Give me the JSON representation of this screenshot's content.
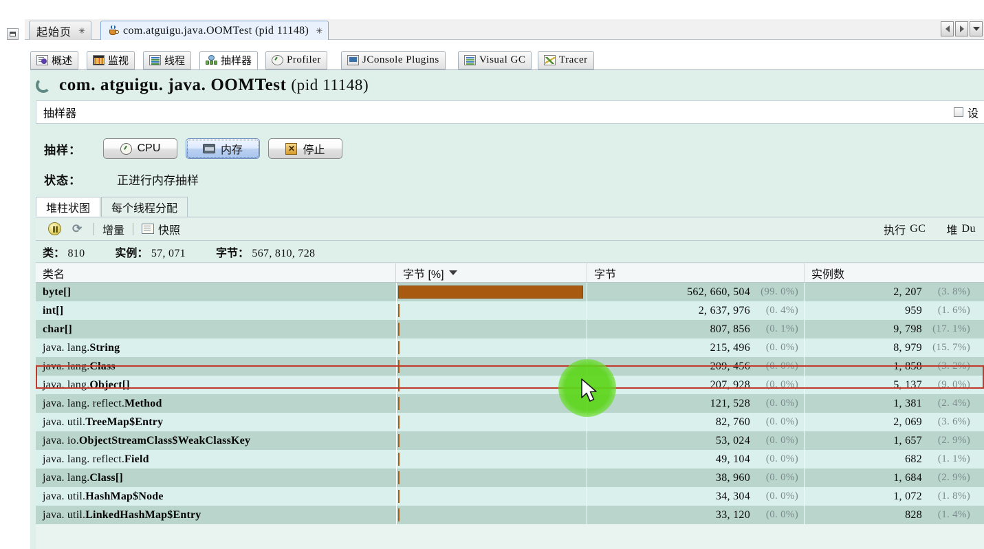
{
  "window": {
    "restore_icon": "restore-window-icon"
  },
  "document_tabs": {
    "tabs": [
      {
        "label": "起始页",
        "active": false,
        "icon": "",
        "close": "✳"
      },
      {
        "label": "com.atguigu.java.OOMTest (pid 11148)",
        "active": true,
        "icon": "java-cup-icon",
        "close": "✳"
      }
    ],
    "nav": {
      "prev": "scroll-left-icon",
      "next": "scroll-right-icon",
      "list": "tab-list-icon"
    }
  },
  "view_tabs": [
    {
      "label": "概述",
      "icon": "overview-icon",
      "active": false,
      "mono": false
    },
    {
      "label": "监视",
      "icon": "monitor-icon",
      "active": false,
      "mono": false
    },
    {
      "label": "线程",
      "icon": "threads-icon",
      "active": false,
      "mono": false
    },
    {
      "label": "抽样器",
      "icon": "sampler-icon",
      "active": true,
      "mono": false
    },
    {
      "label": "Profiler",
      "icon": "profiler-icon",
      "active": false,
      "mono": true
    },
    {
      "label": "JConsole Plugins",
      "icon": "jconsole-icon",
      "active": false,
      "mono": true
    },
    {
      "label": "Visual GC",
      "icon": "visualgc-icon",
      "active": false,
      "mono": true
    },
    {
      "label": "Tracer",
      "icon": "tracer-icon",
      "active": false,
      "mono": true
    }
  ],
  "app_header": {
    "title": "com. atguigu. java. OOMTest",
    "pid": "(pid 11148)",
    "refresh_icon": "refresh-spinner-icon"
  },
  "section": {
    "title": "抽样器",
    "settings_label": "设",
    "settings_checked": false
  },
  "sampling": {
    "label": "抽样：",
    "buttons": [
      {
        "label": "CPU",
        "icon": "clock-icon",
        "selected": false
      },
      {
        "label": "内存",
        "icon": "memory-icon",
        "selected": true
      },
      {
        "label": "停止",
        "icon": "stop-icon",
        "selected": false
      }
    ],
    "status_label": "状态：",
    "status_value": "正进行内存抽样"
  },
  "sub_tabs": [
    {
      "label": "堆柱状图",
      "active": true
    },
    {
      "label": "每个线程分配",
      "active": false
    }
  ],
  "sampler_toolbar": {
    "pause_icon": "pause-icon",
    "refresh_icon": "refresh-icon",
    "delta_label": "增量",
    "snapshot_icon": "snapshot-icon",
    "snapshot_label": "快照",
    "gc_label": "执行",
    "gc_value": "GC",
    "heap_label": "堆",
    "heap_value": "Du"
  },
  "stats": [
    {
      "label": "类：",
      "value": "810"
    },
    {
      "label": "实例：",
      "value": "57, 071"
    },
    {
      "label": "字节：",
      "value": "567, 810, 728"
    }
  ],
  "table": {
    "columns": [
      {
        "label": "类名",
        "sorted": false
      },
      {
        "label": "字节 [%]",
        "sorted": true,
        "caret": "▼"
      },
      {
        "label": "字节",
        "sorted": false
      },
      {
        "label": "实例数",
        "sorted": false
      }
    ],
    "rows": [
      {
        "pkg": "",
        "cls": "byte[]",
        "bar_pct": 99.0,
        "bytes": "562, 660, 504",
        "bytes_pct": "(99. 0%)",
        "instances": "2, 207",
        "inst_pct": "(3. 8%)",
        "selected": true
      },
      {
        "pkg": "",
        "cls": "int[]",
        "bar_pct": 0.4,
        "bytes": "2, 637, 976",
        "bytes_pct": "(0. 4%)",
        "instances": "959",
        "inst_pct": "(1. 6%)",
        "selected": false
      },
      {
        "pkg": "",
        "cls": "char[]",
        "bar_pct": 0.1,
        "bytes": "807, 856",
        "bytes_pct": "(0. 1%)",
        "instances": "9, 798",
        "inst_pct": "(17. 1%)",
        "selected": false
      },
      {
        "pkg": "java. lang.",
        "cls": "String",
        "bar_pct": 0.04,
        "bytes": "215, 496",
        "bytes_pct": "(0. 0%)",
        "instances": "8, 979",
        "inst_pct": "(15. 7%)",
        "selected": false
      },
      {
        "pkg": "java. lang.",
        "cls": "Class",
        "bar_pct": 0.04,
        "bytes": "209, 456",
        "bytes_pct": "(0. 0%)",
        "instances": "1, 858",
        "inst_pct": "(3. 2%)",
        "selected": false
      },
      {
        "pkg": "java. lang.",
        "cls": "Object[]",
        "bar_pct": 0.04,
        "bytes": "207, 928",
        "bytes_pct": "(0. 0%)",
        "instances": "5, 137",
        "inst_pct": "(9. 0%)",
        "selected": false
      },
      {
        "pkg": "java. lang. reflect.",
        "cls": "Method",
        "bar_pct": 0.02,
        "bytes": "121, 528",
        "bytes_pct": "(0. 0%)",
        "instances": "1, 381",
        "inst_pct": "(2. 4%)",
        "selected": false
      },
      {
        "pkg": "java. util.",
        "cls": "TreeMap$Entry",
        "bar_pct": 0.015,
        "bytes": "82, 760",
        "bytes_pct": "(0. 0%)",
        "instances": "2, 069",
        "inst_pct": "(3. 6%)",
        "selected": false
      },
      {
        "pkg": "java. io.",
        "cls": "ObjectStreamClass$WeakClassKey",
        "bar_pct": 0.01,
        "bytes": "53, 024",
        "bytes_pct": "(0. 0%)",
        "instances": "1, 657",
        "inst_pct": "(2. 9%)",
        "selected": false
      },
      {
        "pkg": "java. lang. reflect.",
        "cls": "Field",
        "bar_pct": 0.009,
        "bytes": "49, 104",
        "bytes_pct": "(0. 0%)",
        "instances": "682",
        "inst_pct": "(1. 1%)",
        "selected": false
      },
      {
        "pkg": "java. lang.",
        "cls": "Class[]",
        "bar_pct": 0.007,
        "bytes": "38, 960",
        "bytes_pct": "(0. 0%)",
        "instances": "1, 684",
        "inst_pct": "(2. 9%)",
        "selected": false
      },
      {
        "pkg": "java. util.",
        "cls": "HashMap$Node",
        "bar_pct": 0.006,
        "bytes": "34, 304",
        "bytes_pct": "(0. 0%)",
        "instances": "1, 072",
        "inst_pct": "(1. 8%)",
        "selected": false
      },
      {
        "pkg": "java. util.",
        "cls": "LinkedHashMap$Entry",
        "bar_pct": 0.006,
        "bytes": "33, 120",
        "bytes_pct": "(0. 0%)",
        "instances": "828",
        "inst_pct": "(1. 4%)",
        "selected": false
      }
    ]
  },
  "annotations": {
    "selection_box_color": "#c0392b",
    "cursor_highlight_color": "#5cd61a",
    "bar_color": "#a85a10"
  }
}
